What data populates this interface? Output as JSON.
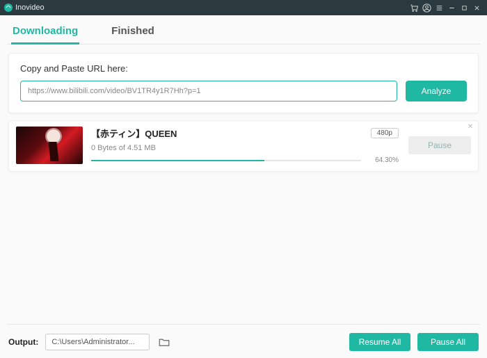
{
  "app": {
    "name": "Inovideo"
  },
  "tabs": {
    "downloading": "Downloading",
    "finished": "Finished",
    "active": "downloading"
  },
  "url_card": {
    "label": "Copy and Paste URL here:",
    "value": "https://www.bilibili.com/video/BV1TR4y1R7Hh?p=1",
    "analyze": "Analyze"
  },
  "download": {
    "title": "【赤ティン】QUEEN",
    "quality": "480p",
    "size_text": "0 Bytes of 4.51 MB",
    "percent_text": "64.30%",
    "percent_css": "width:64.3%",
    "pause": "Pause"
  },
  "footer": {
    "output_label": "Output:",
    "output_path": "C:\\Users\\Administrator...",
    "resume_all": "Resume All",
    "pause_all": "Pause All"
  },
  "colors": {
    "accent": "#1fb9a3"
  }
}
